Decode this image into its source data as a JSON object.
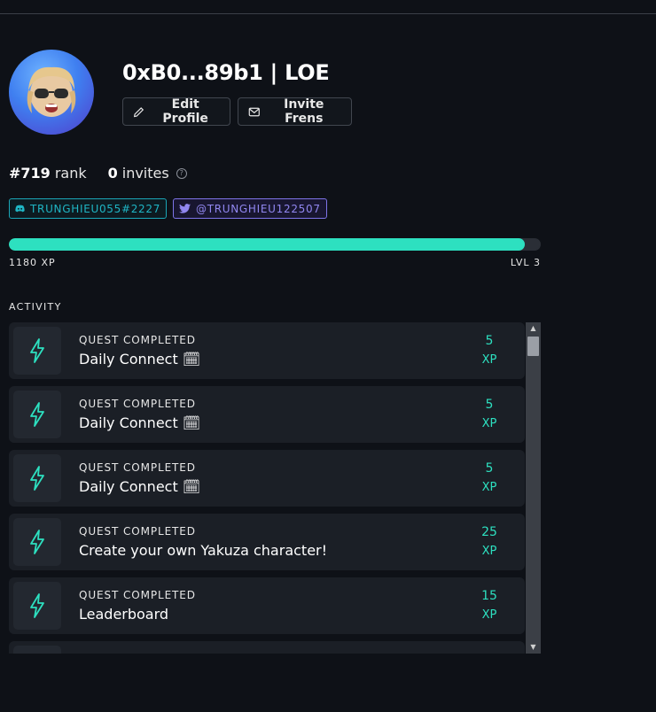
{
  "profile": {
    "title": "0xB0...89b1 | LOE",
    "edit_label": "Edit Profile",
    "invite_label": "Invite Frens",
    "rank_value": "#719",
    "rank_label": "rank",
    "invites_value": "0",
    "invites_label": "invites",
    "help_glyph": "?"
  },
  "social": {
    "discord": "TRUNGHIEU055#2227",
    "twitter": "@TRUNGHIEU122507"
  },
  "xp": {
    "label": "1180 XP",
    "level": "LVL 3",
    "progress": 0.97
  },
  "activity": {
    "heading": "ACTIVITY",
    "items": [
      {
        "kind": "QUEST COMPLETED",
        "name": "Daily Connect 🗓",
        "xp": "5",
        "unit": "XP"
      },
      {
        "kind": "QUEST COMPLETED",
        "name": "Daily Connect 🗓",
        "xp": "5",
        "unit": "XP"
      },
      {
        "kind": "QUEST COMPLETED",
        "name": "Daily Connect 🗓",
        "xp": "5",
        "unit": "XP"
      },
      {
        "kind": "QUEST COMPLETED",
        "name": "Create your own Yakuza character!",
        "xp": "25",
        "unit": "XP"
      },
      {
        "kind": "QUEST COMPLETED",
        "name": "Leaderboard",
        "xp": "15",
        "unit": "XP"
      }
    ]
  },
  "icons": {
    "avatar": "memoji-avatar-icon",
    "edit": "pencil-icon",
    "invite": "mail-icon",
    "help": "help-circle-icon",
    "discord": "discord-icon",
    "twitter": "twitter-icon",
    "activity": "lightning-icon"
  },
  "colors": {
    "accent": "#2de0c0",
    "discord": "#1fb5c4",
    "twitter": "#9187f0",
    "background": "#0e1117"
  }
}
